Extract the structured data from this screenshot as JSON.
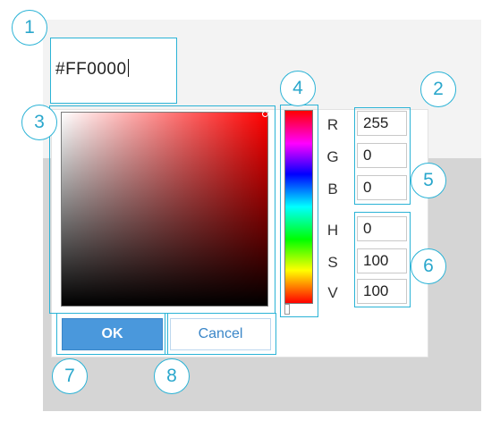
{
  "hex": {
    "prefix": "#",
    "value": "FF0000"
  },
  "color": {
    "selected": "#ff0000",
    "accent": "#2bb3d6",
    "ok_bg": "#4a98dc"
  },
  "channels": {
    "r": {
      "label": "R",
      "value": "255"
    },
    "g": {
      "label": "G",
      "value": "0"
    },
    "b": {
      "label": "B",
      "value": "0"
    },
    "h": {
      "label": "H",
      "value": "0"
    },
    "s": {
      "label": "S",
      "value": "100"
    },
    "v": {
      "label": "V",
      "value": "100"
    }
  },
  "buttons": {
    "ok": "OK",
    "cancel": "Cancel"
  },
  "callouts": [
    "1",
    "2",
    "3",
    "4",
    "5",
    "6",
    "7",
    "8"
  ]
}
